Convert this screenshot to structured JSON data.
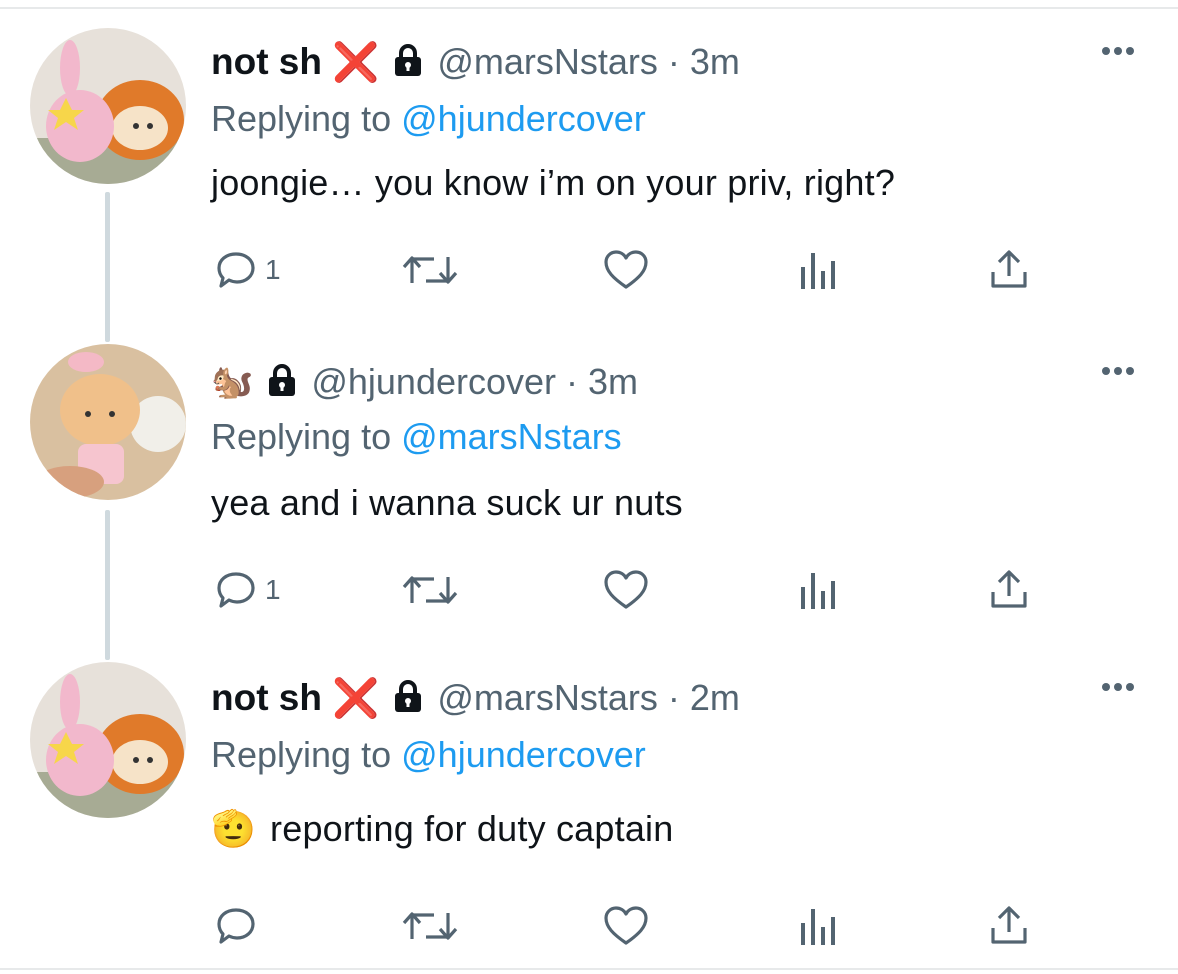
{
  "colors": {
    "name": "#0f1419",
    "muted": "#536471",
    "link": "#1d9bf0",
    "x_mark": "#e0222d",
    "thread_line": "#cfd9de"
  },
  "tweets": [
    {
      "display_name": "not sh",
      "name_badge": "❌",
      "name_emoji": "",
      "locked_icon": "lock-icon",
      "handle": "@marsNstars",
      "separator": "·",
      "time": "3m",
      "replying_prefix": "Replying to",
      "replying_to": "@hjundercover",
      "text": "joongie… you know i’m on your priv, right?",
      "text_emoji": "",
      "reply_count": "1",
      "icons": [
        "reply-icon",
        "retweet-icon",
        "like-icon",
        "views-icon",
        "share-icon"
      ]
    },
    {
      "display_name": "",
      "name_badge": "",
      "name_emoji": "🐿️",
      "locked_icon": "lock-icon",
      "handle": "@hjundercover",
      "separator": "·",
      "time": "3m",
      "replying_prefix": "Replying to",
      "replying_to": "@marsNstars",
      "text": "yea and i wanna suck ur nuts",
      "text_emoji": "",
      "reply_count": "1",
      "icons": [
        "reply-icon",
        "retweet-icon",
        "like-icon",
        "views-icon",
        "share-icon"
      ]
    },
    {
      "display_name": "not sh",
      "name_badge": "❌",
      "name_emoji": "",
      "locked_icon": "lock-icon",
      "handle": "@marsNstars",
      "separator": "·",
      "time": "2m",
      "replying_prefix": "Replying to",
      "replying_to": "@hjundercover",
      "text": "reporting for duty captain",
      "text_emoji": "🫡",
      "reply_count": "",
      "icons": [
        "reply-icon",
        "retweet-icon",
        "like-icon",
        "views-icon",
        "share-icon"
      ]
    }
  ]
}
